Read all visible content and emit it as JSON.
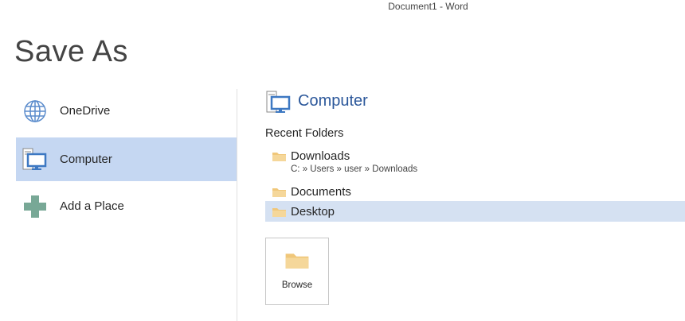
{
  "window_title": "Document1 - Word",
  "page_title": "Save As",
  "nav": [
    {
      "label": "OneDrive",
      "icon": "globe-icon"
    },
    {
      "label": "Computer",
      "icon": "computer-icon",
      "selected": true
    },
    {
      "label": "Add a Place",
      "icon": "plus-icon"
    }
  ],
  "right": {
    "heading": "Computer",
    "recent_label": "Recent Folders",
    "folders": [
      {
        "name": "Downloads",
        "path": "C: » Users » user » Downloads"
      },
      {
        "name": "Documents"
      },
      {
        "name": "Desktop",
        "highlighted": true
      }
    ],
    "browse_label": "Browse"
  },
  "colors": {
    "accent": "#2b579a",
    "selected": "#c5d7f2",
    "hover": "#d5e1f2",
    "folder": "#f0c77a",
    "plus": "#78a896"
  }
}
